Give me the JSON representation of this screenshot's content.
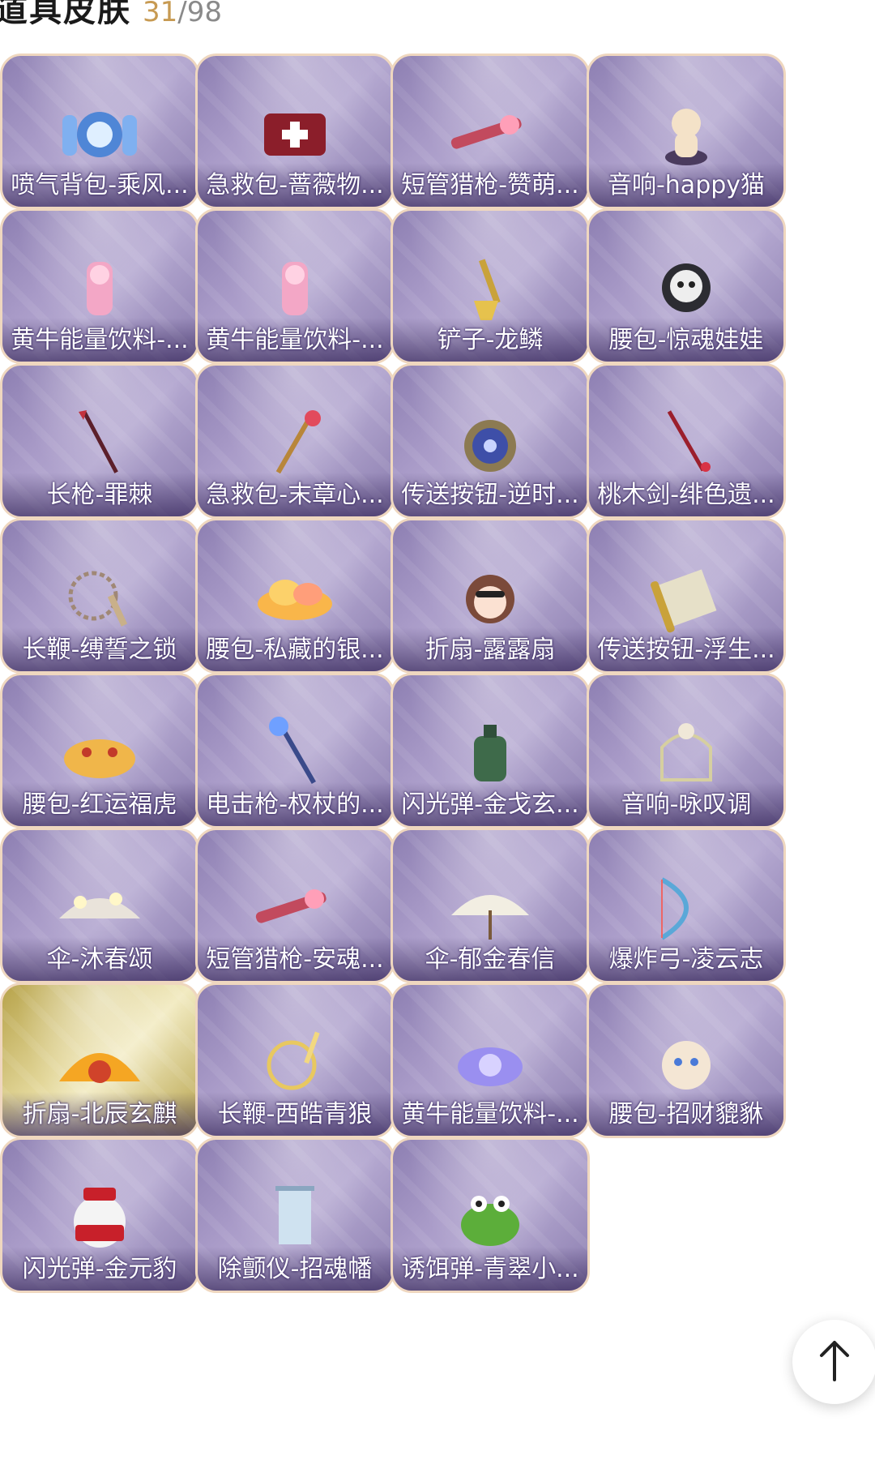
{
  "header": {
    "title": "道具皮肤",
    "owned": "31",
    "separator": "/",
    "total": "98"
  },
  "items": [
    {
      "label": "喷气背包-乘风...",
      "icon": "jetpack-icon"
    },
    {
      "label": "急救包-蔷薇物...",
      "icon": "first-aid-kit-icon"
    },
    {
      "label": "短管猎枪-赞萌...",
      "icon": "shotgun-icon"
    },
    {
      "label": "音响-happy猫",
      "icon": "cat-speaker-icon"
    },
    {
      "label": "黄牛能量饮料-...",
      "icon": "energy-drink-icon"
    },
    {
      "label": "黄牛能量饮料-...",
      "icon": "energy-drink-icon"
    },
    {
      "label": "铲子-龙鳞",
      "icon": "shovel-icon"
    },
    {
      "label": "腰包-惊魂娃娃",
      "icon": "skull-pouch-icon"
    },
    {
      "label": "长枪-罪棘",
      "icon": "spear-icon"
    },
    {
      "label": "急救包-末章心...",
      "icon": "scepter-icon"
    },
    {
      "label": "传送按钮-逆时...",
      "icon": "pocket-watch-icon"
    },
    {
      "label": "桃木剑-绯色遗...",
      "icon": "sword-icon"
    },
    {
      "label": "长鞭-缚誓之锁",
      "icon": "chain-whip-icon"
    },
    {
      "label": "腰包-私藏的银...",
      "icon": "cloud-pouch-icon"
    },
    {
      "label": "折扇-露露扇",
      "icon": "girl-fan-icon"
    },
    {
      "label": "传送按钮-浮生...",
      "icon": "scroll-icon"
    },
    {
      "label": "腰包-红运福虎",
      "icon": "tiger-pouch-icon"
    },
    {
      "label": "电击枪-权杖的...",
      "icon": "staff-icon"
    },
    {
      "label": "闪光弹-金戈玄...",
      "icon": "flashbang-icon"
    },
    {
      "label": "音响-咏叹调",
      "icon": "birdcage-icon"
    },
    {
      "label": "伞-沐春颂",
      "icon": "flower-umbrella-icon"
    },
    {
      "label": "短管猎枪-安魂...",
      "icon": "shotgun-icon"
    },
    {
      "label": "伞-郁金春信",
      "icon": "paper-umbrella-icon"
    },
    {
      "label": "爆炸弓-凌云志",
      "icon": "bow-icon"
    },
    {
      "label": "折扇-北辰玄麒",
      "icon": "golden-fan-icon"
    },
    {
      "label": "长鞭-西皓青狼",
      "icon": "whip-icon"
    },
    {
      "label": "黄牛能量饮料-...",
      "icon": "flower-drink-icon"
    },
    {
      "label": "腰包-招财貔貅",
      "icon": "pixiu-pouch-icon"
    },
    {
      "label": "闪光弹-金元豹",
      "icon": "panda-bomb-icon"
    },
    {
      "label": "除颤仪-招魂幡",
      "icon": "banner-icon"
    },
    {
      "label": "诱饵弹-青翠小...",
      "icon": "frog-icon"
    }
  ],
  "scroll_top": {
    "icon": "arrow-up-icon"
  },
  "colors": {
    "tile_purple": "#a99bc8",
    "tile_gold": "#e3d79a",
    "tile_border": "#efd7bf",
    "owned_count": "#c79a52",
    "title": "#1a1a1a"
  }
}
